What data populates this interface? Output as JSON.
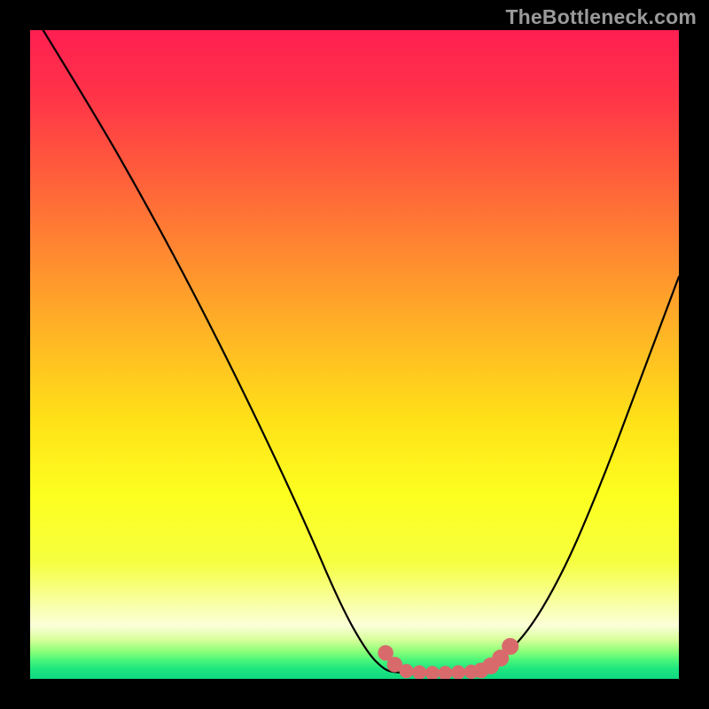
{
  "watermark": "TheBottleneck.com",
  "colors": {
    "background": "#000000",
    "curve": "#000000",
    "marker": "#d96a6c",
    "gradient_stops": [
      {
        "offset": 0.0,
        "color": "#ff1f52"
      },
      {
        "offset": 0.1,
        "color": "#ff3348"
      },
      {
        "offset": 0.22,
        "color": "#ff5d3c"
      },
      {
        "offset": 0.35,
        "color": "#ff8b30"
      },
      {
        "offset": 0.48,
        "color": "#ffb924"
      },
      {
        "offset": 0.6,
        "color": "#ffe118"
      },
      {
        "offset": 0.72,
        "color": "#fcff20"
      },
      {
        "offset": 0.82,
        "color": "#f6ff40"
      },
      {
        "offset": 0.885,
        "color": "#f8ffa6"
      },
      {
        "offset": 0.918,
        "color": "#fbffd8"
      },
      {
        "offset": 0.94,
        "color": "#d6ff9a"
      },
      {
        "offset": 0.958,
        "color": "#8aff78"
      },
      {
        "offset": 0.972,
        "color": "#47f57a"
      },
      {
        "offset": 0.985,
        "color": "#1de680"
      },
      {
        "offset": 1.0,
        "color": "#0fd97f"
      }
    ]
  },
  "chart_data": {
    "type": "line",
    "title": "",
    "xlabel": "",
    "ylabel": "",
    "xlim": [
      0,
      100
    ],
    "ylim": [
      0,
      100
    ],
    "series": [
      {
        "name": "left-curve",
        "x": [
          2,
          10,
          18,
          26,
          34,
          42,
          48,
          52,
          54.5,
          56
        ],
        "y": [
          100,
          87,
          73,
          58,
          42,
          25,
          11,
          4,
          1.5,
          1
        ]
      },
      {
        "name": "flat-min",
        "x": [
          56,
          60,
          64,
          68,
          70
        ],
        "y": [
          1,
          0.8,
          0.8,
          1,
          1.2
        ]
      },
      {
        "name": "right-curve",
        "x": [
          70,
          76,
          82,
          88,
          94,
          100
        ],
        "y": [
          1.2,
          6,
          16,
          30,
          46,
          62
        ]
      }
    ],
    "markers": {
      "name": "highlight-dots",
      "color": "#d96a6c",
      "points": [
        {
          "x": 54.8,
          "y": 4.0,
          "r": 1.2
        },
        {
          "x": 56.2,
          "y": 2.2,
          "r": 1.2
        },
        {
          "x": 58.0,
          "y": 1.2,
          "r": 1.1
        },
        {
          "x": 60.0,
          "y": 1.0,
          "r": 1.1
        },
        {
          "x": 62.0,
          "y": 0.9,
          "r": 1.1
        },
        {
          "x": 64.0,
          "y": 0.9,
          "r": 1.1
        },
        {
          "x": 66.0,
          "y": 1.0,
          "r": 1.1
        },
        {
          "x": 68.0,
          "y": 1.1,
          "r": 1.1
        },
        {
          "x": 69.5,
          "y": 1.3,
          "r": 1.2
        },
        {
          "x": 71.0,
          "y": 2.0,
          "r": 1.3
        },
        {
          "x": 72.5,
          "y": 3.2,
          "r": 1.3
        },
        {
          "x": 74.0,
          "y": 5.0,
          "r": 1.3
        }
      ]
    }
  }
}
